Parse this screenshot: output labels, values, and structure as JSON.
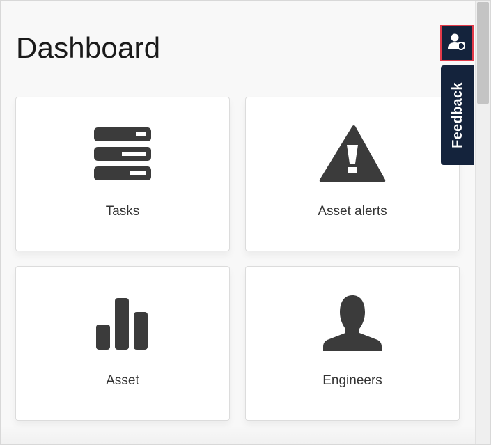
{
  "header": {
    "title": "Dashboard"
  },
  "tiles": [
    {
      "label": "Tasks",
      "icon": "tasks-list-icon"
    },
    {
      "label": "Asset alerts",
      "icon": "warning-triangle-icon"
    },
    {
      "label": "Asset",
      "icon": "bar-chart-icon"
    },
    {
      "label": "Engineers",
      "icon": "user-silhouette-icon"
    }
  ],
  "side": {
    "user_switch_icon": "user-switch-icon",
    "feedback_label": "Feedback"
  },
  "colors": {
    "icon": "#3b3b3b",
    "navy": "#14233c",
    "highlight": "#e23b4a",
    "tile_border": "#dcdcdc",
    "background": "#f8f8f8"
  }
}
